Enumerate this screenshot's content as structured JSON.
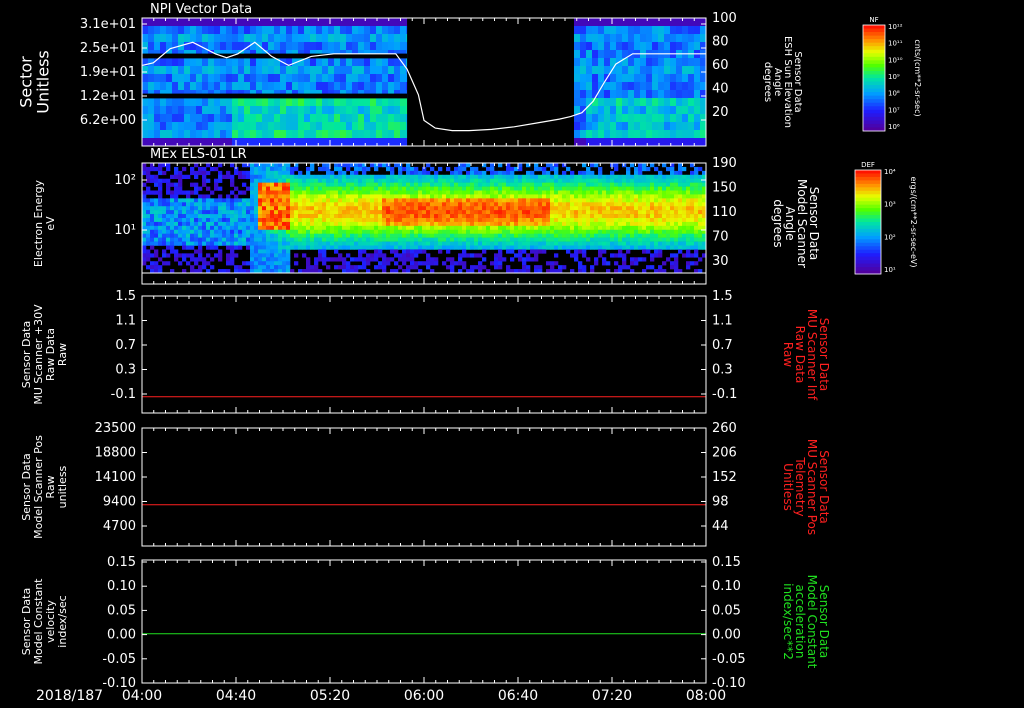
{
  "colors": {
    "background": "#000000",
    "axis": "#ffffff",
    "red_trace": "#ff2020",
    "green_trace": "#20e020",
    "white_trace": "#ffffff"
  },
  "time_axis": {
    "date": "2018/187",
    "ticks": [
      "04:00",
      "04:40",
      "05:20",
      "06:00",
      "06:40",
      "07:20",
      "08:00"
    ]
  },
  "chart_data": [
    {
      "type": "heatmap",
      "title": "NPI Vector Data",
      "ylabel": [
        "Sector",
        "Unitless"
      ],
      "yticks": [
        "3.1e+01",
        "2.5e+01",
        "1.9e+01",
        "1.2e+01",
        "6.2e+00"
      ],
      "right_label": [
        "Sensor Data",
        "ESH Sun Elevation",
        "Angle",
        "degrees"
      ],
      "right_ticks": [
        "100",
        "80",
        "60",
        "40",
        "20"
      ],
      "right_range": [
        0,
        100
      ],
      "overlay_line": {
        "name": "ESH Sun Elevation Angle",
        "x": [
          0.0,
          0.02,
          0.05,
          0.09,
          0.13,
          0.15,
          0.17,
          0.2,
          0.23,
          0.26,
          0.3,
          0.34,
          0.38,
          0.42,
          0.45,
          0.47,
          0.49,
          0.5,
          0.52,
          0.55,
          0.58,
          0.62,
          0.66,
          0.7,
          0.74,
          0.76,
          0.78,
          0.8,
          0.82,
          0.84,
          0.87,
          0.9,
          0.94,
          1.0
        ],
        "y": [
          63,
          65,
          76,
          81,
          72,
          69,
          72,
          81,
          70,
          63,
          70,
          72,
          72,
          72,
          72,
          60,
          40,
          20,
          14,
          12,
          12,
          13,
          15,
          18,
          21,
          23,
          26,
          35,
          50,
          64,
          72,
          72,
          72,
          72
        ]
      },
      "data_gap": [
        0.47,
        0.76
      ],
      "colorbar": {
        "label": "NF",
        "units": "cnts/(cm**2-sr-sec)",
        "ticks": [
          "10¹²",
          "10¹¹",
          "10¹⁰",
          "10⁹",
          "10⁸",
          "10⁷",
          "10⁶"
        ]
      }
    },
    {
      "type": "heatmap",
      "title": "MEx ELS-01 LR",
      "ylabel": [
        "Electron Energy",
        "eV"
      ],
      "yticks": [
        "10²",
        "10¹"
      ],
      "right_label": [
        "Sensor Data",
        "Model Scanner",
        "Angle",
        "degrees"
      ],
      "right_ticks": [
        "190",
        "150",
        "110",
        "70",
        "30"
      ],
      "right_range": [
        10,
        190
      ],
      "colorbar": {
        "label": "DEF",
        "units": "ergs/(cm**2-sr-sec-eV)",
        "ticks": [
          "10⁴",
          "10³",
          "10²",
          "10¹"
        ]
      }
    },
    {
      "type": "line",
      "ylabel": [
        "Sensor Data",
        "MU Scanner +30V",
        "Raw Data",
        "Raw"
      ],
      "yticks": [
        "1.5",
        "1.1",
        "0.7",
        "0.3",
        "-0.1"
      ],
      "ylim": [
        -0.3,
        1.5
      ],
      "right_label": [
        "Sensor Data",
        "MU Scanner Inf",
        "Raw Data",
        "Raw"
      ],
      "right_ticks": [
        "1.5",
        "1.1",
        "0.7",
        "0.3",
        "-0.1"
      ],
      "series": [
        {
          "color": "#ff2020",
          "x": [
            0,
            1
          ],
          "y": [
            -0.05,
            -0.05
          ]
        }
      ]
    },
    {
      "type": "line",
      "ylabel": [
        "Sensor Data",
        "Model Scanner Pos",
        "Raw",
        "unitless"
      ],
      "yticks": [
        "23500",
        "18800",
        "14100",
        "9400",
        "4700"
      ],
      "ylim": [
        0,
        23500
      ],
      "right_label": [
        "Sensor Data",
        "MU Scanner Pos",
        "Telemetry",
        "Unitless"
      ],
      "right_ticks": [
        "260",
        "206",
        "152",
        "98",
        "44"
      ],
      "series": [
        {
          "color": "#ff2020",
          "x": [
            0,
            1
          ],
          "y": [
            8200,
            8200
          ]
        }
      ]
    },
    {
      "type": "line",
      "ylabel": [
        "Sensor Data",
        "Model Constant",
        "velocity",
        "index/sec"
      ],
      "yticks": [
        "0.15",
        "0.10",
        "0.05",
        "0.00",
        "-0.05",
        "-0.10"
      ],
      "ylim": [
        -0.1,
        0.15
      ],
      "right_label": [
        "Sensor Data",
        "Model Constant",
        "acceleration",
        "index/sec**2"
      ],
      "right_ticks": [
        "0.15",
        "0.10",
        "0.05",
        "0.00",
        "-0.05",
        "-0.10"
      ],
      "series": [
        {
          "color": "#20e020",
          "x": [
            0,
            1
          ],
          "y": [
            0.0,
            0.0
          ]
        }
      ]
    }
  ]
}
